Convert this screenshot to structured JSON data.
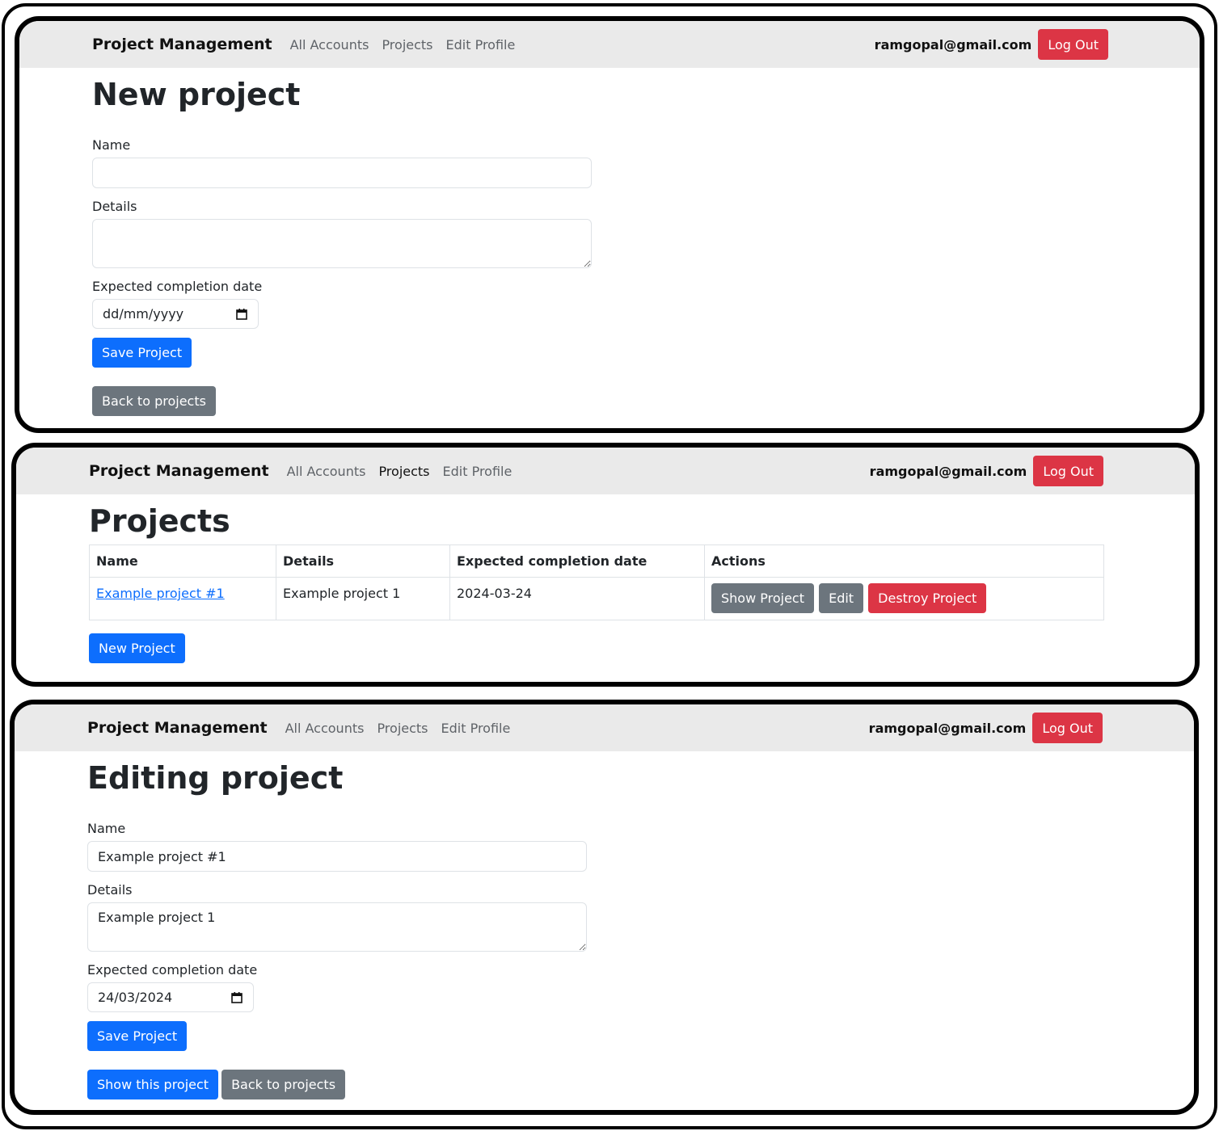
{
  "nav": {
    "brand": "Project Management",
    "links": [
      "All Accounts",
      "Projects",
      "Edit Profile"
    ],
    "user_email": "ramgopal@gmail.com",
    "logout_label": "Log Out"
  },
  "new_project": {
    "title": "New project",
    "name_label": "Name",
    "name_value": "",
    "details_label": "Details",
    "details_value": "",
    "date_label": "Expected completion date",
    "date_value": "dd/mm/yyyy",
    "save_label": "Save Project",
    "back_label": "Back to projects"
  },
  "projects_index": {
    "title": "Projects",
    "columns": [
      "Name",
      "Details",
      "Expected completion date",
      "Actions"
    ],
    "rows": [
      {
        "name": "Example project #1",
        "details": "Example project 1",
        "date": "2024-03-24",
        "actions": [
          "Show Project",
          "Edit",
          "Destroy Project"
        ]
      }
    ],
    "new_label": "New Project"
  },
  "edit_project": {
    "title": "Editing project",
    "name_label": "Name",
    "name_value": "Example project #1",
    "details_label": "Details",
    "details_value": "Example project 1",
    "date_label": "Expected completion date",
    "date_value": "24/03/2024",
    "save_label": "Save Project",
    "show_label": "Show this project",
    "back_label": "Back to projects"
  },
  "colors": {
    "primary": "#0d6efd",
    "danger": "#dc3545",
    "secondary": "#6c757d",
    "navbar_bg": "#eaeaea"
  },
  "icons": [
    "calendar-icon"
  ]
}
